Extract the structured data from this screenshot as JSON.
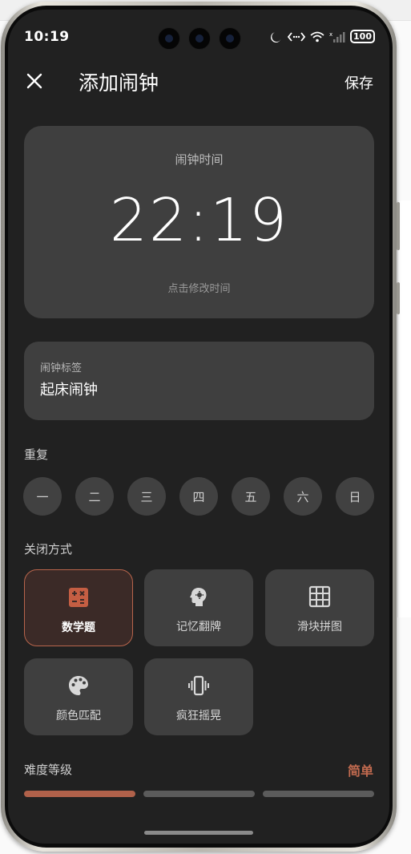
{
  "status_bar": {
    "time": "10:19",
    "battery": "100",
    "icons": [
      "moon-icon",
      "data-arrows-icon",
      "wifi-icon",
      "cell-signal-icon",
      "battery-icon"
    ]
  },
  "header": {
    "title": "添加闹钟",
    "save_label": "保存",
    "close_icon": "close-icon"
  },
  "time_card": {
    "label": "闹钟时间",
    "time": "22:19",
    "hint": "点击修改时间"
  },
  "tag_card": {
    "label": "闹钟标签",
    "value": "起床闹钟"
  },
  "repeat": {
    "title": "重复",
    "days": [
      "一",
      "二",
      "三",
      "四",
      "五",
      "六",
      "日"
    ]
  },
  "dismiss": {
    "title": "关闭方式",
    "methods": [
      {
        "label": "数学题",
        "icon": "calculator-icon",
        "selected": true
      },
      {
        "label": "记忆翻牌",
        "icon": "brain-icon",
        "selected": false
      },
      {
        "label": "滑块拼图",
        "icon": "grid-icon",
        "selected": false
      },
      {
        "label": "颜色匹配",
        "icon": "palette-icon",
        "selected": false
      },
      {
        "label": "疯狂摇晃",
        "icon": "vibrate-icon",
        "selected": false
      }
    ]
  },
  "difficulty": {
    "title": "难度等级",
    "value": "简单",
    "level": 1,
    "levels_total": 3
  },
  "colors": {
    "background": "#212121",
    "card": "#3f3f3f",
    "accent": "#c06a4f",
    "selected_card": "#3b2a27"
  }
}
